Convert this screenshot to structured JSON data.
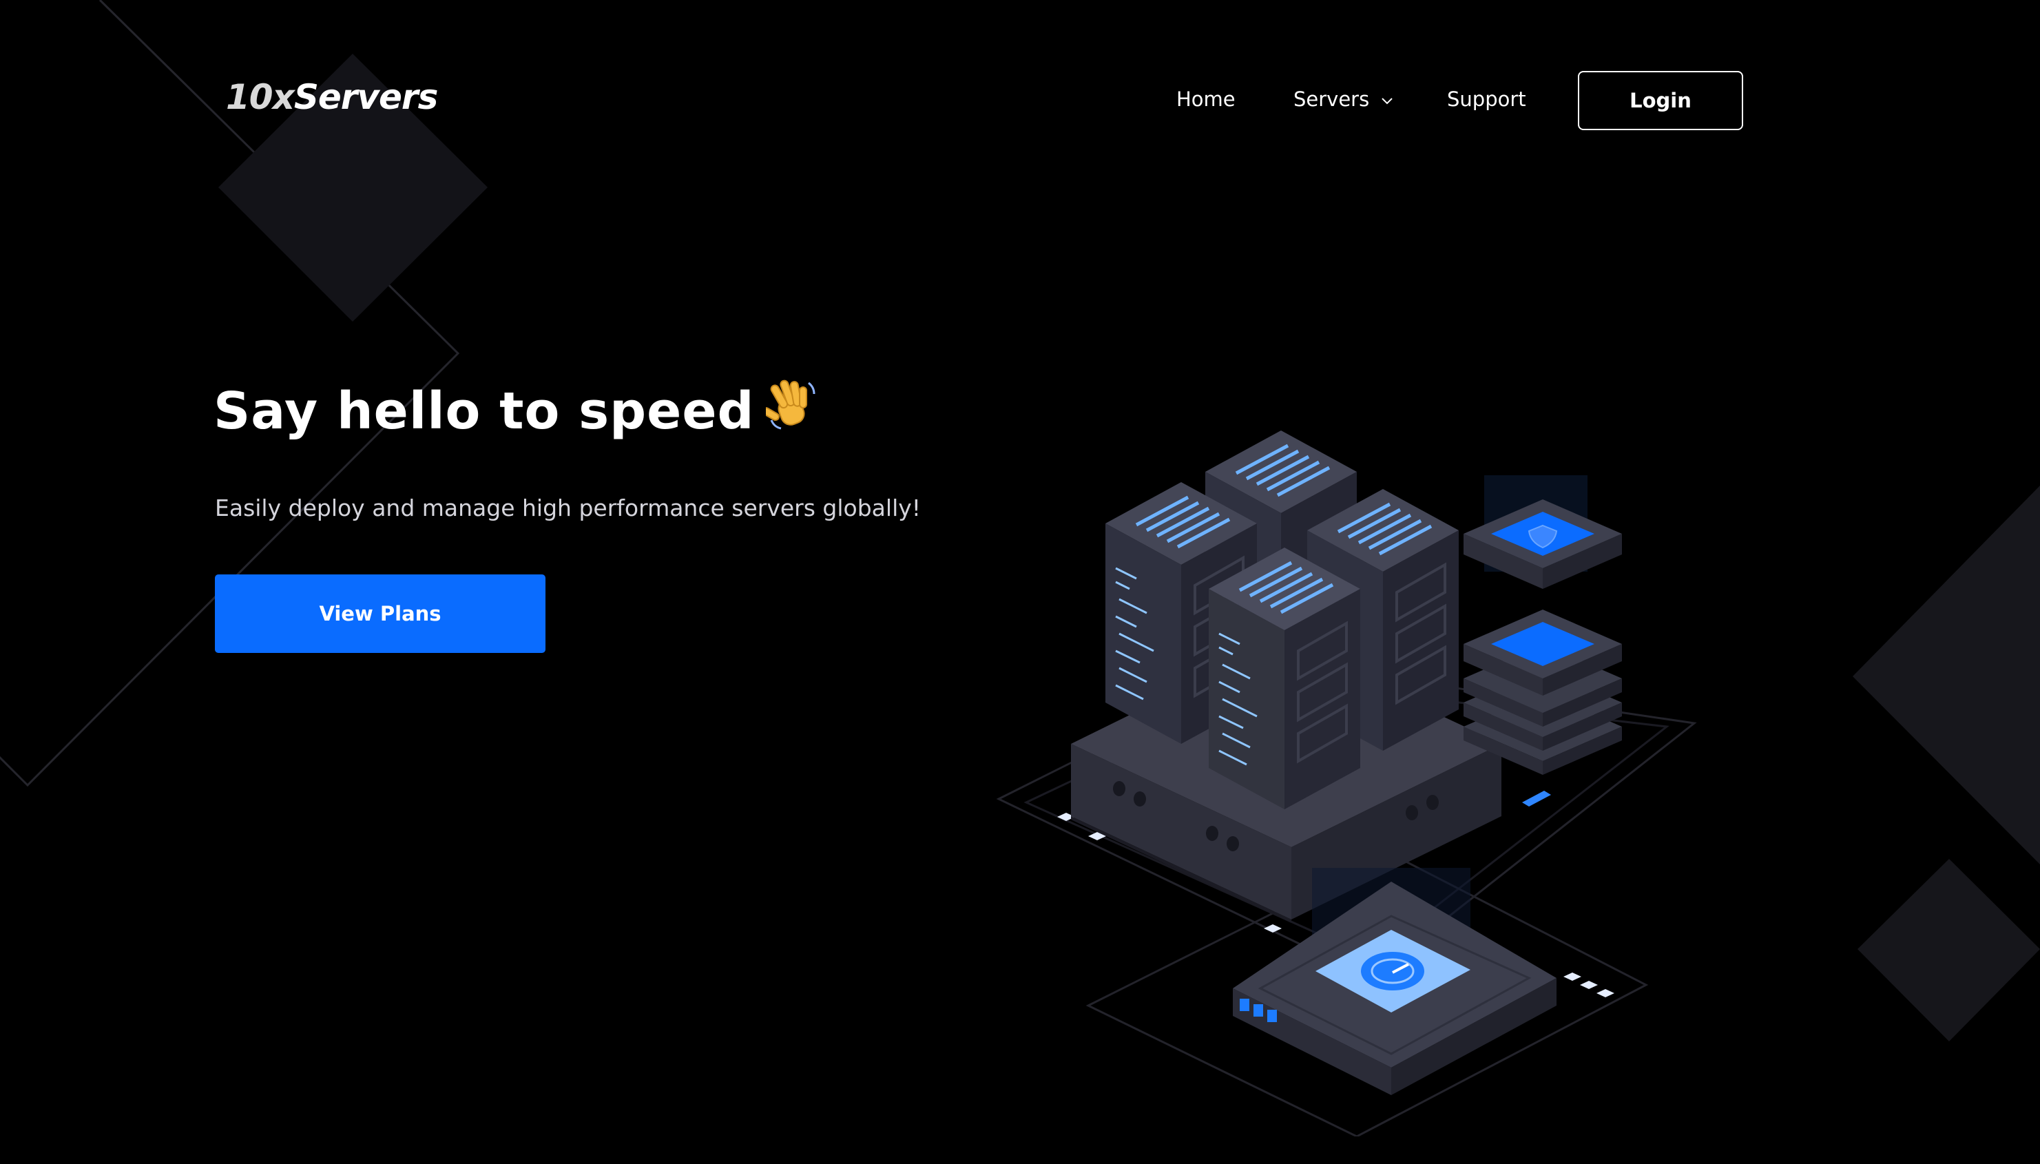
{
  "brand": {
    "logo_prefix": "10x",
    "logo_name": "Servers"
  },
  "nav": {
    "items": [
      {
        "label": "Home"
      },
      {
        "label": "Servers"
      },
      {
        "label": "Support"
      }
    ],
    "login_label": "Login"
  },
  "hero": {
    "headline": "Say hello to speed",
    "subtitle": "Easily deploy and manage high performance servers globally!",
    "cta_label": "View Plans"
  },
  "colors": {
    "background": "#000000",
    "accent": "#0a6cff",
    "text": "#ffffff",
    "muted_text": "#d5d5dc"
  },
  "icons": [
    "chevron-down-icon",
    "waving-hand-icon",
    "shield-icon",
    "speedometer-icon"
  ]
}
